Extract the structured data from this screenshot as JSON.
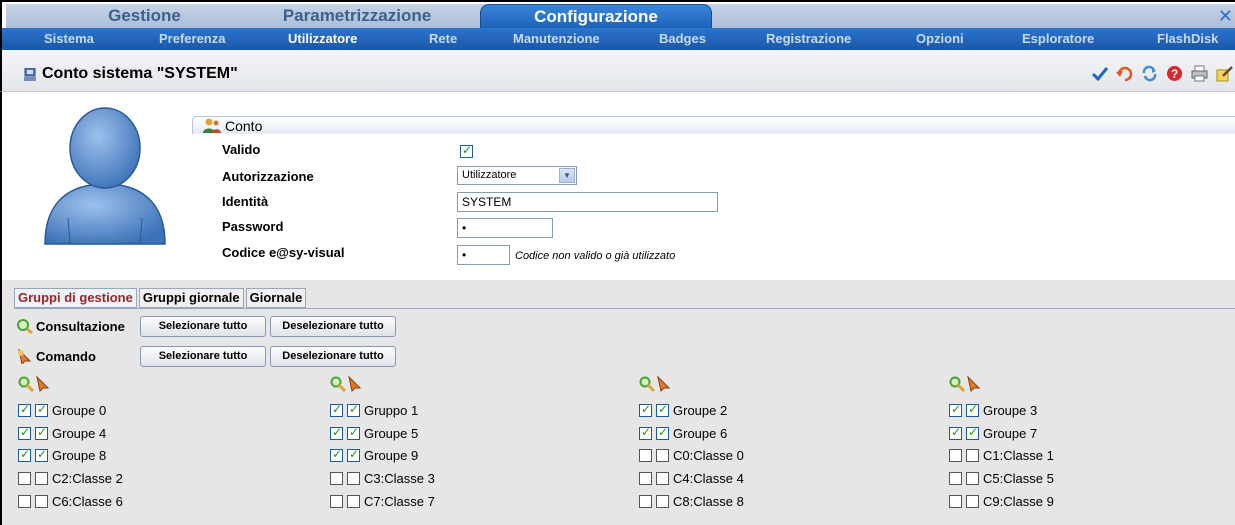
{
  "top_tabs": [
    {
      "label": "Gestione",
      "active": false
    },
    {
      "label": "Parametrizzazione",
      "active": false
    },
    {
      "label": "Configurazione",
      "active": true
    }
  ],
  "sub_nav": [
    {
      "label": "Sistema",
      "active": false
    },
    {
      "label": "Preferenza",
      "active": false
    },
    {
      "label": "Utilizzatore",
      "active": true
    },
    {
      "label": "Rete",
      "active": false
    },
    {
      "label": "Manutenzione",
      "active": false
    },
    {
      "label": "Badges",
      "active": false
    },
    {
      "label": "Registrazione",
      "active": false
    },
    {
      "label": "Opzioni",
      "active": false
    },
    {
      "label": "Esploratore",
      "active": false
    },
    {
      "label": "FlashDisk",
      "active": false
    }
  ],
  "page_title": "Conto sistema \"SYSTEM\"",
  "toolbar": [
    "check-icon",
    "undo-icon",
    "refresh-icon",
    "help-icon",
    "print-icon",
    "edit-icon"
  ],
  "section": {
    "title": "Conto"
  },
  "form": {
    "valido_label": "Valido",
    "valido_checked": true,
    "autorizzazione_label": "Autorizzazione",
    "autorizzazione_value": "Utilizzatore",
    "identita_label": "Identità",
    "identita_value": "SYSTEM",
    "password_label": "Password",
    "password_value": "•",
    "codice_label": "Codice e@sy-visual",
    "codice_value": "•",
    "codice_hint": "Codice non valido o già utilizzato"
  },
  "bottom_tabs": [
    {
      "label": "Gruppi di gestione",
      "active": true
    },
    {
      "label": "Gruppi giornale",
      "active": false
    },
    {
      "label": "Giornale",
      "active": false
    }
  ],
  "permissions": {
    "consultazione_label": "Consultazione",
    "comando_label": "Comando",
    "select_all": "Selezionare tutto",
    "deselect_all": "Deselezionare tutto"
  },
  "groups": [
    [
      {
        "label": "Groupe 0",
        "consult": true,
        "command": true
      },
      {
        "label": "Groupe 4",
        "consult": true,
        "command": true
      },
      {
        "label": "Groupe 8",
        "consult": true,
        "command": true
      },
      {
        "label": "C2:Classe 2",
        "consult": false,
        "command": false
      },
      {
        "label": "C6:Classe 6",
        "consult": false,
        "command": false
      }
    ],
    [
      {
        "label": "Gruppo 1",
        "consult": true,
        "command": true
      },
      {
        "label": "Groupe 5",
        "consult": true,
        "command": true
      },
      {
        "label": "Groupe 9",
        "consult": true,
        "command": true
      },
      {
        "label": "C3:Classe 3",
        "consult": false,
        "command": false
      },
      {
        "label": "C7:Classe 7",
        "consult": false,
        "command": false
      }
    ],
    [
      {
        "label": "Groupe 2",
        "consult": true,
        "command": true
      },
      {
        "label": "Groupe 6",
        "consult": true,
        "command": true
      },
      {
        "label": "C0:Classe 0",
        "consult": false,
        "command": false
      },
      {
        "label": "C4:Classe 4",
        "consult": false,
        "command": false
      },
      {
        "label": "C8:Classe 8",
        "consult": false,
        "command": false
      }
    ],
    [
      {
        "label": "Groupe 3",
        "consult": true,
        "command": true
      },
      {
        "label": "Groupe 7",
        "consult": true,
        "command": true
      },
      {
        "label": "C1:Classe 1",
        "consult": false,
        "command": false
      },
      {
        "label": "C5:Classe 5",
        "consult": false,
        "command": false
      },
      {
        "label": "C9:Classe 9",
        "consult": false,
        "command": false
      }
    ]
  ],
  "colors": {
    "accent": "#1c5fb5",
    "active_tab_text": "#9c2525",
    "check": "#2e8b1f"
  }
}
